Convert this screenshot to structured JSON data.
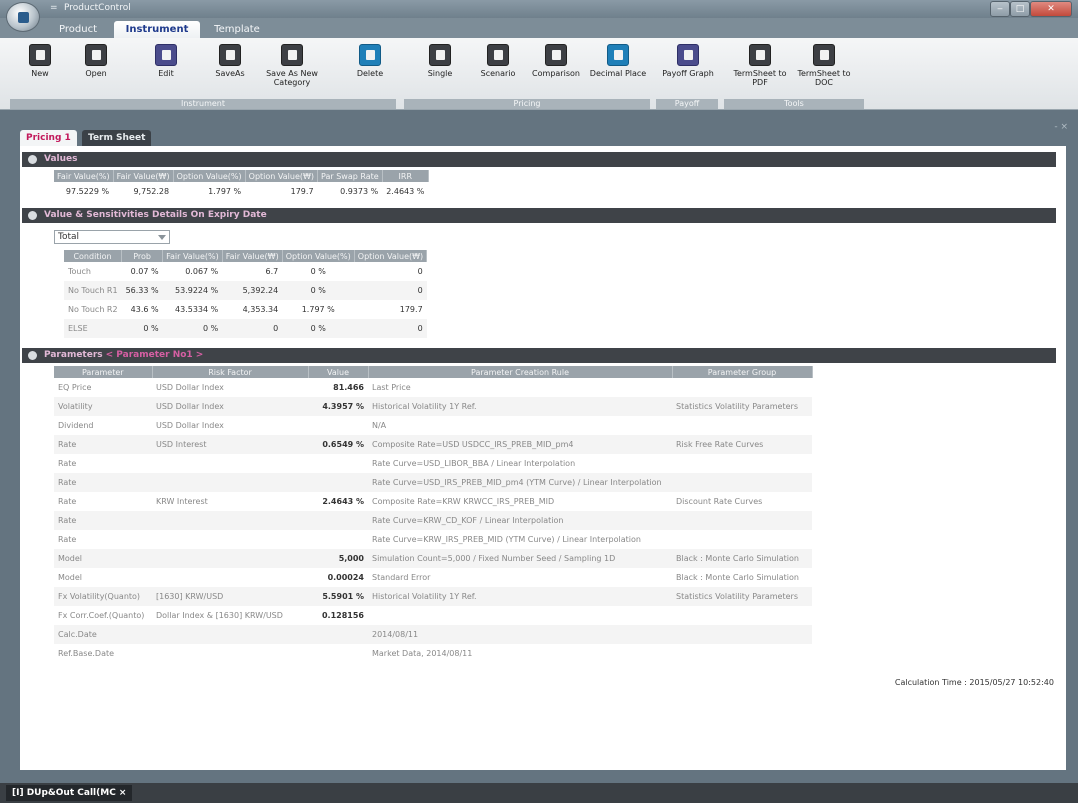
{
  "window": {
    "title": "ProductControl",
    "quick_access": "="
  },
  "ribbon_tabs": [
    "Product",
    "Instrument",
    "Template"
  ],
  "ribbon_buttons": {
    "new": "New",
    "open": "Open",
    "edit": "Edit",
    "saveas": "SaveAs",
    "save_new_category": "Save As New Category",
    "delete": "Delete",
    "single": "Single",
    "scenario": "Scenario",
    "comparison": "Comparison",
    "decimal_place": "Decimal Place",
    "payoff_graph": "Payoff Graph",
    "termsheet_pdf": "TermSheet to PDF",
    "termsheet_doc": "TermSheet to DOC"
  },
  "ribbon_groups": {
    "instrument": "Instrument",
    "pricing": "Pricing",
    "payoff": "Payoff",
    "tools": "Tools"
  },
  "doc_tabs": [
    "Pricing 1",
    "Term Sheet"
  ],
  "pane_controls": "- ×",
  "sections": {
    "values": "Values",
    "details": "Value & Sensitivities Details On Expiry Date",
    "parameters": "Parameters",
    "parameters_nav": "< Parameter No1 >"
  },
  "values_table": {
    "headers": [
      "Fair Value(%)",
      "Fair Value(₩)",
      "Option Value(%)",
      "Option Value(₩)",
      "Par Swap Rate",
      "IRR"
    ],
    "row": [
      "97.5229 %",
      "9,752.28",
      "1.797 %",
      "179.7",
      "0.9373 %",
      "2.4643 %"
    ]
  },
  "details_filter": "Total",
  "details_table": {
    "headers": [
      "Condition",
      "Prob",
      "Fair Value(%)",
      "Fair Value(₩)",
      "Option Value(%)",
      "Option Value(₩)"
    ],
    "rows": [
      [
        "Touch",
        "0.07 %",
        "0.067 %",
        "6.7",
        "0 %",
        "0"
      ],
      [
        "No Touch R1",
        "56.33 %",
        "53.9224 %",
        "5,392.24",
        "0 %",
        "0"
      ],
      [
        "No Touch R2",
        "43.6 %",
        "43.5334 %",
        "4,353.34",
        "1.797 %",
        "179.7"
      ],
      [
        "ELSE",
        "0 %",
        "0 %",
        "0",
        "0 %",
        "0"
      ]
    ]
  },
  "parameters_table": {
    "headers": [
      "Parameter",
      "Risk Factor",
      "Value",
      "Parameter Creation Rule",
      "Parameter Group"
    ],
    "rows": [
      [
        "EQ Price",
        "USD Dollar Index",
        "81.466",
        "Last Price",
        ""
      ],
      [
        "Volatility",
        "USD Dollar Index",
        "4.3957 %",
        "Historical Volatility 1Y Ref.",
        "Statistics Volatility Parameters"
      ],
      [
        "Dividend",
        "USD Dollar Index",
        "",
        "N/A",
        ""
      ],
      [
        "Rate",
        "USD Interest",
        "0.6549 %",
        "Composite Rate=USD USDCC_IRS_PREB_MID_pm4",
        "Risk Free Rate Curves"
      ],
      [
        "Rate",
        "",
        "",
        "Rate Curve=USD_LIBOR_BBA / Linear Interpolation",
        ""
      ],
      [
        "Rate",
        "",
        "",
        "Rate Curve=USD_IRS_PREB_MID_pm4 (YTM Curve) / Linear Interpolation",
        ""
      ],
      [
        "Rate",
        "KRW Interest",
        "2.4643 %",
        "Composite Rate=KRW KRWCC_IRS_PREB_MID",
        "Discount Rate Curves"
      ],
      [
        "Rate",
        "",
        "",
        "Rate Curve=KRW_CD_KOF / Linear Interpolation",
        ""
      ],
      [
        "Rate",
        "",
        "",
        "Rate Curve=KRW_IRS_PREB_MID (YTM Curve) / Linear Interpolation",
        ""
      ],
      [
        "Model",
        "",
        "5,000",
        "Simulation Count=5,000 / Fixed Number Seed / Sampling 1D",
        "Black : Monte Carlo Simulation"
      ],
      [
        "Model",
        "",
        "0.00024",
        "Standard Error",
        "Black : Monte Carlo Simulation"
      ],
      [
        "Fx Volatility(Quanto)",
        "[1630] KRW/USD",
        "5.5901 %",
        "Historical Volatility 1Y Ref.",
        "Statistics Volatility Parameters"
      ],
      [
        "Fx Corr.Coef.(Quanto)",
        "Dollar Index & [1630] KRW/USD",
        "0.128156",
        "",
        ""
      ],
      [
        "Calc.Date",
        "",
        "",
        "2014/08/11",
        ""
      ],
      [
        "Ref.Base.Date",
        "",
        "",
        "Market Data, 2014/08/11",
        ""
      ]
    ]
  },
  "calculation_time": "Calculation Time : 2015/05/27 10:52:40",
  "status_tab": "[I] DUp&Out Call(MC ×",
  "colors": {
    "accent": "#c2185b",
    "ribbon_active": "#1e3a8c",
    "section_bg": "#3f4348"
  }
}
